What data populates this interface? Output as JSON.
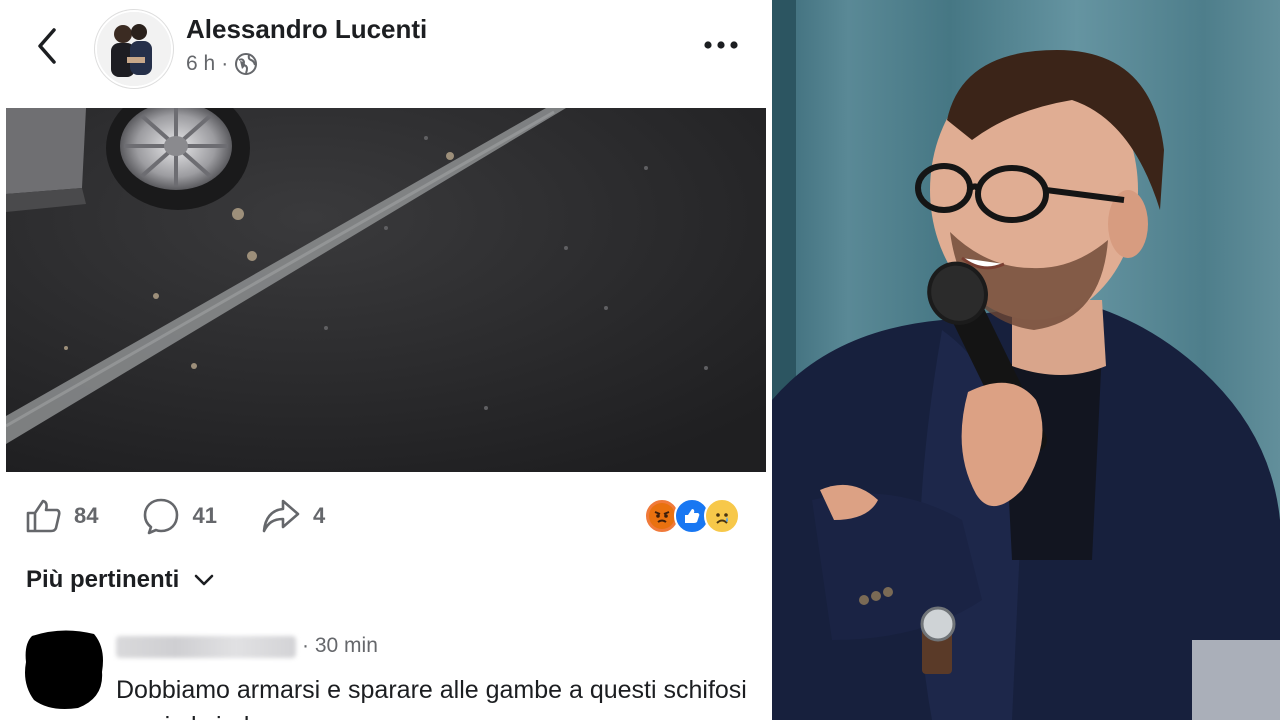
{
  "post": {
    "author": "Alessandro Lucenti",
    "time": "6 h",
    "dot": "·",
    "stats": {
      "likes": "84",
      "comments": "41",
      "shares": "4"
    },
    "sort_label": "Più pertinenti"
  },
  "comment": {
    "time": "30 min",
    "text": "Dobbiamo armarsi e sparare alle gambe a questi schifosi e poi al sindaco"
  },
  "icons": [
    "back-icon",
    "avatar",
    "globe-icon",
    "more-icon",
    "like-icon",
    "comment-icon",
    "share-icon",
    "angry-reaction-icon",
    "like-reaction-icon",
    "sad-reaction-icon",
    "chevron-down-icon"
  ],
  "colors": {
    "text": "#1c1e21",
    "secondary": "#65676b",
    "like_blue": "#1877f2",
    "angry": "#e9710f"
  }
}
